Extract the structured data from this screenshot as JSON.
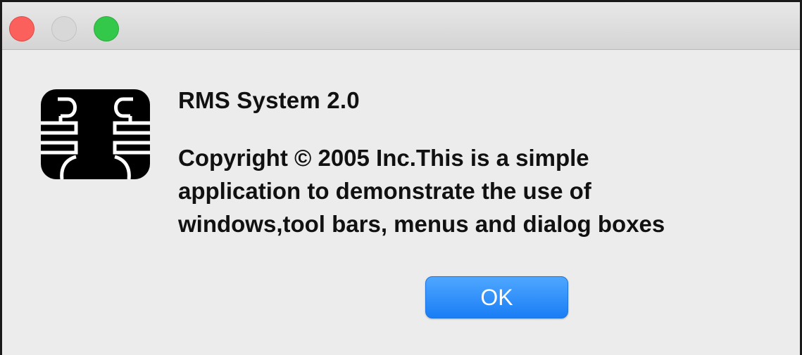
{
  "window": {
    "controls": {
      "close": "close-button",
      "minimize": "minimize-button",
      "zoom": "zoom-button"
    }
  },
  "dialog": {
    "icon": "chip-icon",
    "title": "RMS System 2.0",
    "message_lines": [
      "Copyright © 2005 Inc.This is a simple",
      "application to demonstrate the use of",
      "windows,tool bars, menus and dialog boxes"
    ],
    "ok_label": "OK"
  },
  "colors": {
    "close": "#fc605c",
    "minimize": "#d8d8d8",
    "zoom": "#34c84a",
    "button_accent": "#1a7df5",
    "background": "#ececec"
  }
}
